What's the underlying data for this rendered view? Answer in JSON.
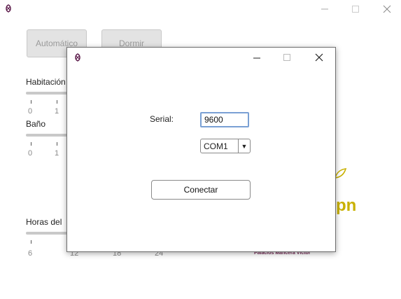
{
  "main_window": {
    "buttons": {
      "auto": "Automático",
      "sleep": "Dormir"
    },
    "sections": {
      "room": "Habitación",
      "bath": "Baño",
      "hours": "Horas del"
    },
    "room_ticks": [
      "0",
      "1"
    ],
    "bath_ticks": [
      "0",
      "1"
    ],
    "hour_ticks": [
      "6",
      "12",
      "18",
      "24"
    ],
    "logo_fragment": "pn",
    "credit": "Palacios Mancera Víctor"
  },
  "dialog": {
    "serial_label": "Serial:",
    "baud_value": "9600",
    "port_value": "COM1",
    "connect_label": "Conectar"
  },
  "colors": {
    "accent_input_border": "#7aa0d4",
    "logo": "#c9b100",
    "credit": "#7a2f5a"
  }
}
